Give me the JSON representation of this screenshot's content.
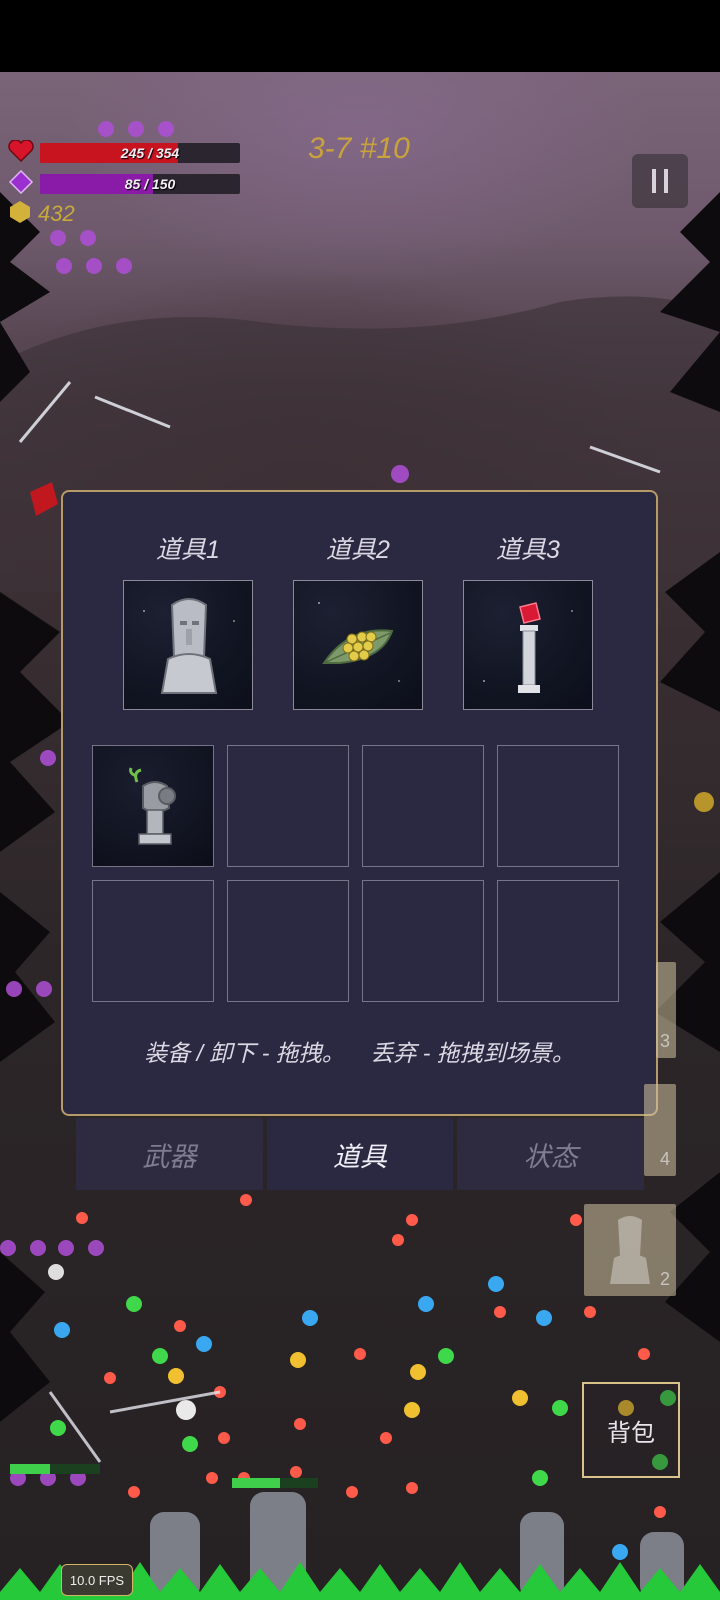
{
  "hud": {
    "health": {
      "text": "245 / 354",
      "current": 245,
      "max": 354,
      "color": "#c8141f"
    },
    "mana": {
      "text": "85 / 150",
      "current": 85,
      "max": 150,
      "color": "#8a1aa8"
    },
    "gold": "432",
    "level": "3-7 #10",
    "icons": {
      "health": "heart-icon",
      "mana": "diamond-icon",
      "gold": "coin-icon",
      "pause": "pause-icon"
    }
  },
  "panel": {
    "equip_slots": [
      {
        "label": "道具1",
        "item_icon": "moai-statue-icon"
      },
      {
        "label": "道具2",
        "item_icon": "leaf-with-seeds-icon"
      },
      {
        "label": "道具3",
        "item_icon": "red-gem-pillar-icon"
      }
    ],
    "inventory": [
      {
        "item_icon": "sprout-stone-head-icon"
      },
      {
        "item_icon": null
      },
      {
        "item_icon": null
      },
      {
        "item_icon": null
      },
      {
        "item_icon": null
      },
      {
        "item_icon": null
      },
      {
        "item_icon": null
      },
      {
        "item_icon": null
      }
    ],
    "hint": "装备 / 卸下 - 拖拽。    丢弃 - 拖拽到场景。"
  },
  "tabs": [
    {
      "label": "武器",
      "active": false
    },
    {
      "label": "道具",
      "active": true
    },
    {
      "label": "状态",
      "active": false
    }
  ],
  "side_cards": [
    {
      "num": "3"
    },
    {
      "num": "4"
    },
    {
      "num": "2"
    }
  ],
  "bag_button": "背包",
  "fps": "10.0 FPS",
  "colors": {
    "panel_bg": "#2b2841",
    "panel_border": "#b69a68",
    "level_text": "#c9a23c",
    "gold_text": "#c7a93a"
  }
}
